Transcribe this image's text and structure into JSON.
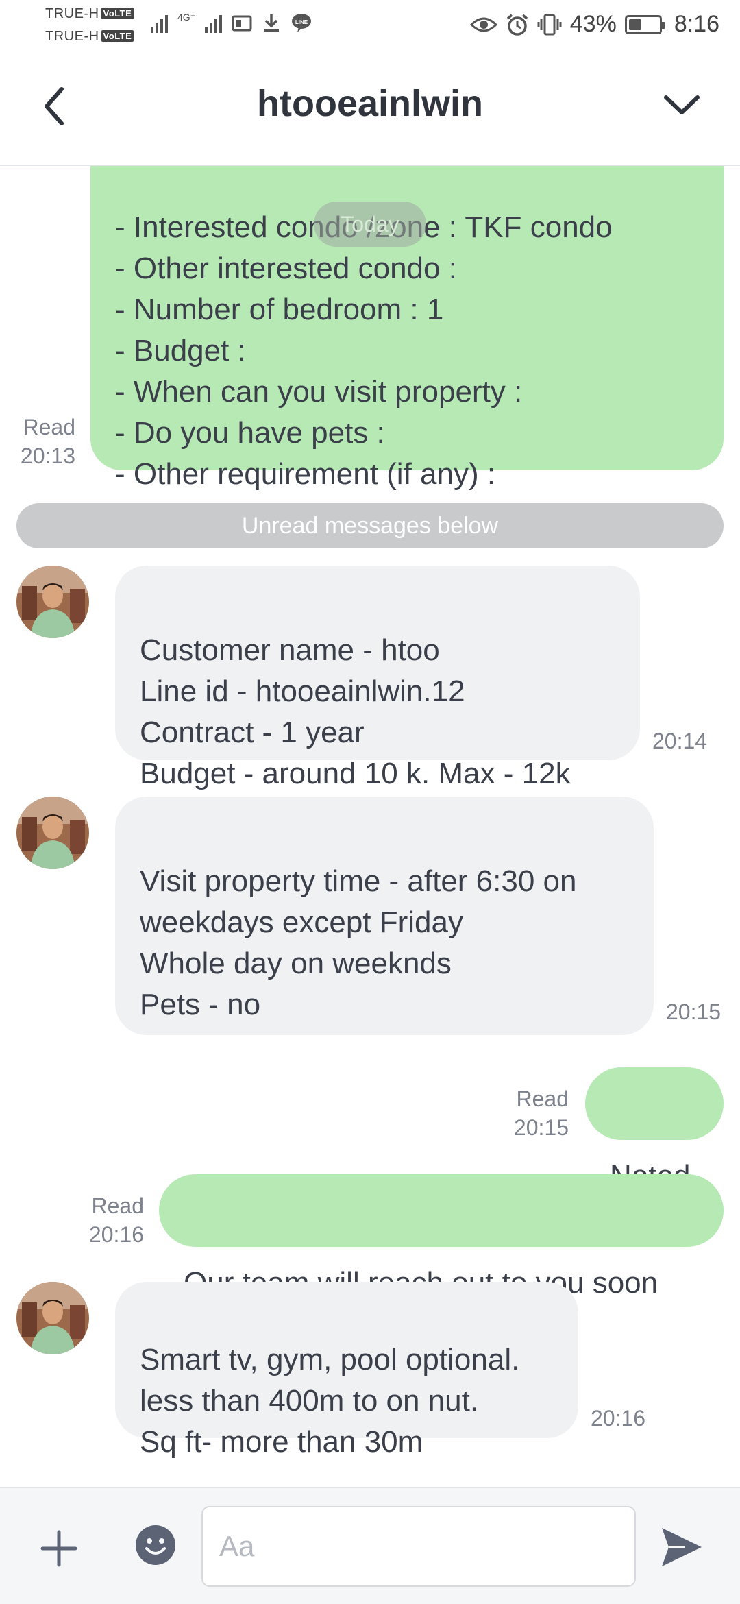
{
  "status_bar": {
    "carrier1": "TRUE-H",
    "carrier2": "TRUE-H",
    "volte": "VoLTE",
    "network": "4G⁺",
    "battery_percent": "43%",
    "battery_level": 0.43,
    "time": "8:16"
  },
  "header": {
    "title": "htooeainlwin"
  },
  "chat": {
    "day_pill": "Today",
    "outgoing_form": {
      "text": "- Interested condo /zone : TKF condo\n- Other interested condo :\n- Number of bedroom  : 1\n- Budget :\n- When can you visit property :\n- Do you have pets :\n- Other requirement (if any) :",
      "status": "Read",
      "time": "20:13"
    },
    "unread_divider": "Unread messages below",
    "incoming1": {
      "text": "Customer name - htoo\nLine id - htooeainlwin.12\nContract - 1 year\nBudget - around 10 k.  Max - 12k",
      "time": "20:14"
    },
    "incoming2": {
      "text": "Visit property time - after 6:30 on\nweekdays except Friday\nWhole day on weeknds\nPets - no",
      "time": "20:15"
    },
    "outgoing_noted": {
      "text": "Noted",
      "status": "Read",
      "time": "20:15"
    },
    "outgoing_team": {
      "text": "Our team will reach out to you soon",
      "status": "Read",
      "time": "20:16"
    },
    "incoming3": {
      "text": "Smart tv, gym, pool optional.\nless than 400m to on nut.\nSq ft- more than 30m",
      "time": "20:16"
    }
  },
  "composer": {
    "placeholder": "Aa"
  },
  "colors": {
    "outgoing_bubble": "#b7e9b5",
    "incoming_bubble": "#f0f1f3",
    "icon": "#5c6374"
  },
  "icons": [
    "back-arrow-icon",
    "chevron-down-icon",
    "plus-icon",
    "emoji-icon",
    "send-icon"
  ]
}
